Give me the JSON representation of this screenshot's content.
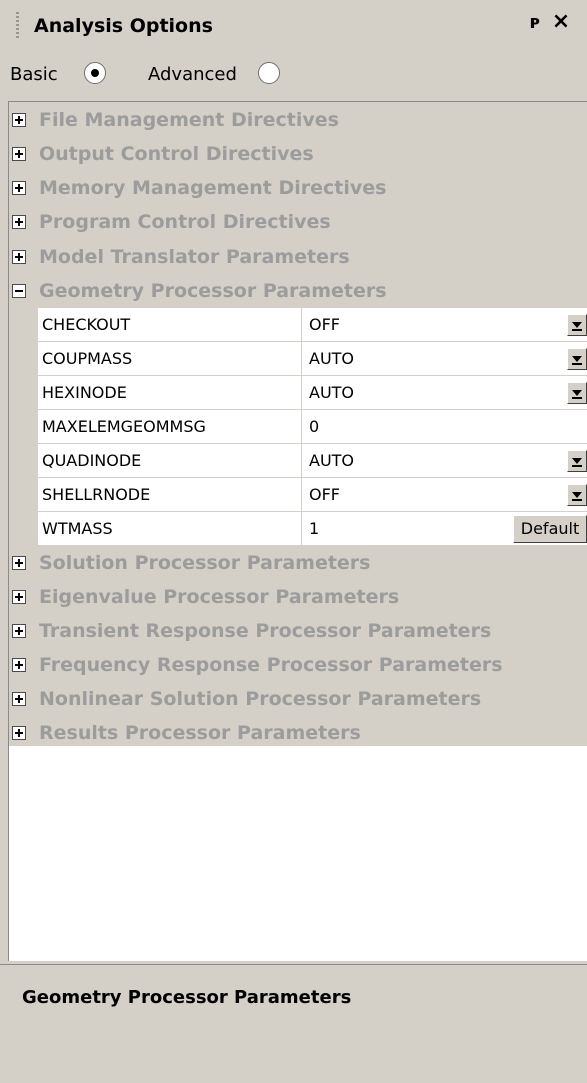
{
  "panel": {
    "title": "Analysis Options"
  },
  "mode": {
    "basic_label": "Basic",
    "advanced_label": "Advanced",
    "selected": "Basic"
  },
  "tree": {
    "groups_before": [
      {
        "label": "File Management Directives",
        "expanded": false
      },
      {
        "label": "Output Control Directives",
        "expanded": false
      },
      {
        "label": "Memory Management Directives",
        "expanded": false
      },
      {
        "label": "Program Control Directives",
        "expanded": false
      },
      {
        "label": "Model Translator Parameters",
        "expanded": false
      }
    ],
    "expanded_group": {
      "label": "Geometry Processor Parameters",
      "expanded": true,
      "params": [
        {
          "name": "CHECKOUT",
          "value": "OFF",
          "control": "dropdown"
        },
        {
          "name": "COUPMASS",
          "value": "AUTO",
          "control": "dropdown"
        },
        {
          "name": "HEXINODE",
          "value": "AUTO",
          "control": "dropdown"
        },
        {
          "name": "MAXELEMGEOMMSG",
          "value": "0",
          "control": "none"
        },
        {
          "name": "QUADINODE",
          "value": "AUTO",
          "control": "dropdown"
        },
        {
          "name": "SHELLRNODE",
          "value": "OFF",
          "control": "dropdown"
        },
        {
          "name": "WTMASS",
          "value": "1",
          "control": "button",
          "button_label": "Default"
        }
      ]
    },
    "groups_after": [
      {
        "label": "Solution Processor Parameters",
        "expanded": false
      },
      {
        "label": "Eigenvalue Processor Parameters",
        "expanded": false
      },
      {
        "label": "Transient Response Processor Parameters",
        "expanded": false
      },
      {
        "label": "Frequency Response Processor Parameters",
        "expanded": false
      },
      {
        "label": "Nonlinear Solution Processor Parameters",
        "expanded": false
      },
      {
        "label": "Results Processor Parameters",
        "expanded": false
      }
    ]
  },
  "description": {
    "title": "Geometry Processor Parameters"
  },
  "icons": {
    "pin": "pin-icon",
    "close": "close-icon",
    "expand": "plus-box-icon",
    "collapse": "minus-box-icon",
    "dropdown": "chevron-down-icon"
  }
}
